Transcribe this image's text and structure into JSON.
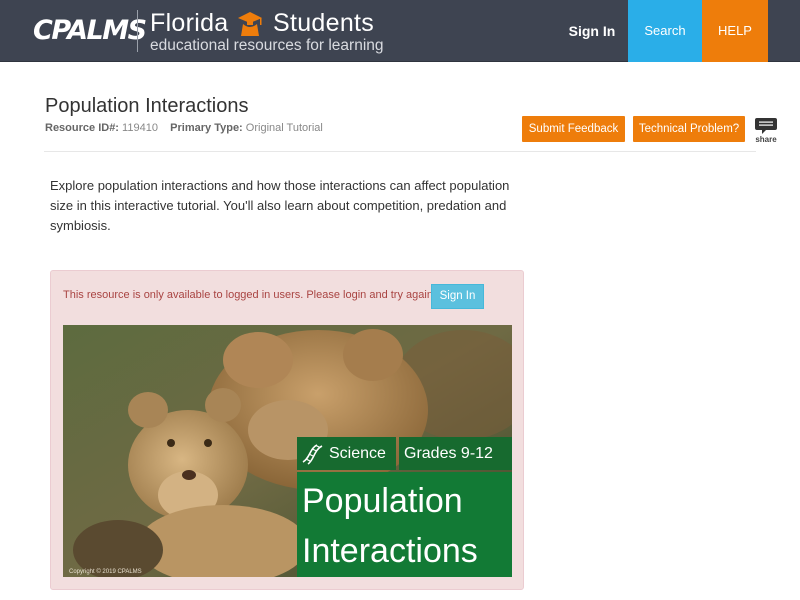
{
  "header": {
    "logo_text": "CPALMS",
    "brand_word1": "Florida",
    "brand_word2": "Students",
    "tagline": "educational resources for learning",
    "nav": {
      "signin": "Sign In",
      "search": "Search",
      "help": "HELP"
    },
    "colors": {
      "bar": "#3e4451",
      "search": "#2aaee8",
      "help": "#ee7d0b"
    }
  },
  "resource": {
    "title": "Population Interactions",
    "id_label": "Resource ID#:",
    "id_value": "119410",
    "type_label": "Primary Type:",
    "type_value": "Original Tutorial",
    "submit_feedback": "Submit Feedback",
    "technical_problem": "Technical Problem?",
    "share_label": "share",
    "description": "Explore population interactions and how those interactions can affect population size in this interactive tutorial. You'll also learn about competition, predation and symbiosis."
  },
  "alert": {
    "message": "This resource is only available to logged in users. Please login and try again.",
    "signin_button": "Sign In"
  },
  "hero": {
    "subject": "Science",
    "grades": "Grades 9-12",
    "title_line1": "Population",
    "title_line2": "Interactions",
    "copyright": "Copyright © 2019 CPALMS"
  }
}
